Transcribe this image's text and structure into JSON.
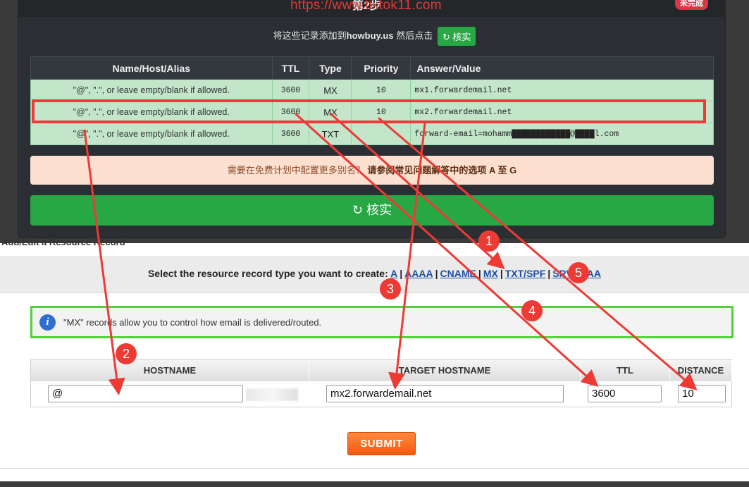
{
  "watermark": "https://www.tiktok11.com",
  "step_title": "第2步",
  "corner_badge": "未完成",
  "instruction": {
    "prefix": "将这些记录添加到",
    "domain": "howbuy.us",
    "suffix": " 然后点击",
    "verify_icon": "refresh-icon",
    "verify_label": "核实"
  },
  "dns_table": {
    "headers": [
      "Name/Host/Alias",
      "TTL",
      "Type",
      "Priority",
      "Answer/Value"
    ],
    "rows": [
      {
        "name": "\"@\", \".\", or leave empty/blank if allowed.",
        "ttl": "3600",
        "type": "MX",
        "priority": "10",
        "answer": "mx1.forwardemail.net"
      },
      {
        "name": "\"@\", \".\", or leave empty/blank if allowed.",
        "ttl": "3600",
        "type": "MX",
        "priority": "10",
        "answer": "mx2.forwardemail.net"
      },
      {
        "name": "\"@\", \".\", or leave empty/blank if allowed.",
        "ttl": "3600",
        "type": "TXT",
        "priority": "",
        "answer": "forward-email=mohamm████████████@████l.com"
      }
    ]
  },
  "note": {
    "text": "需要在免费计划中配置更多别名？",
    "link": "请参阅常见问题解答中的选项 A 至 G"
  },
  "big_verify_label": "核实",
  "control_panel": {
    "title": "Add/Edit a Resource Record",
    "type_prompt": "Select the resource record type you want to create:",
    "types": [
      "A",
      "AAAA",
      "CNAME",
      "MX",
      "TXT/SPF",
      "SRV",
      "CAA"
    ],
    "info_text": "\"MX\" records allow you to control how email is delivered/routed.",
    "columns": [
      "HOSTNAME",
      "TARGET HOSTNAME",
      "TTL",
      "DISTANCE"
    ],
    "values": {
      "hostname": "@",
      "target": "mx2.forwardemail.net",
      "ttl": "3600",
      "distance": "10"
    },
    "submit_label": "SUBMIT"
  },
  "annotations": {
    "markers": [
      "1",
      "2",
      "3",
      "4",
      "5"
    ],
    "color": "#ee3a35"
  },
  "colors": {
    "green": "#28a745",
    "row_green": "#c3e6cb",
    "dark_panel": "#2b2f33",
    "highlight_red": "#f23838",
    "submit_orange": "#f25a0f",
    "info_border": "#53d13a"
  }
}
